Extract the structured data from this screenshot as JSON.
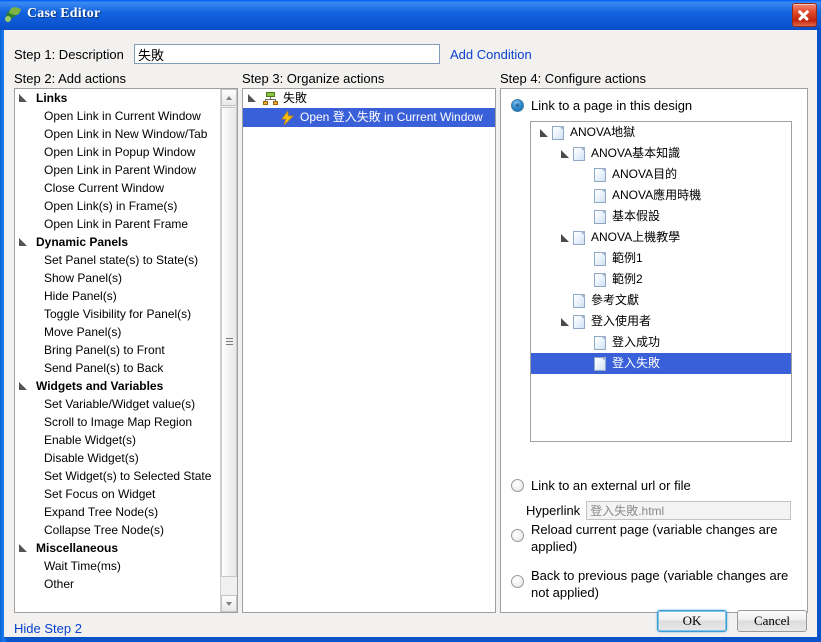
{
  "window": {
    "title": "Case Editor",
    "app_icon": "butterfly-icon",
    "close_icon": "close-icon"
  },
  "step1": {
    "label": "Step 1: Description",
    "description_value": "失敗",
    "description_placeholder": "",
    "add_condition": "Add Condition"
  },
  "headings": {
    "step2": "Step 2: Add actions",
    "step3": "Step 3: Organize actions",
    "step4": "Step 4: Configure actions"
  },
  "actions": [
    {
      "type": "group",
      "label": "Links"
    },
    {
      "type": "item",
      "label": "Open Link in Current Window"
    },
    {
      "type": "item",
      "label": "Open Link in New Window/Tab"
    },
    {
      "type": "item",
      "label": "Open Link in Popup Window"
    },
    {
      "type": "item",
      "label": "Open Link in Parent Window"
    },
    {
      "type": "item",
      "label": "Close Current Window"
    },
    {
      "type": "item",
      "label": "Open Link(s) in Frame(s)"
    },
    {
      "type": "item",
      "label": "Open Link in Parent Frame"
    },
    {
      "type": "group",
      "label": "Dynamic Panels"
    },
    {
      "type": "item",
      "label": "Set Panel state(s) to State(s)"
    },
    {
      "type": "item",
      "label": "Show Panel(s)"
    },
    {
      "type": "item",
      "label": "Hide Panel(s)"
    },
    {
      "type": "item",
      "label": "Toggle Visibility for Panel(s)"
    },
    {
      "type": "item",
      "label": "Move Panel(s)"
    },
    {
      "type": "item",
      "label": "Bring Panel(s) to Front"
    },
    {
      "type": "item",
      "label": "Send Panel(s) to Back"
    },
    {
      "type": "group",
      "label": "Widgets and Variables"
    },
    {
      "type": "item",
      "label": "Set Variable/Widget value(s)"
    },
    {
      "type": "item",
      "label": "Scroll to Image Map Region"
    },
    {
      "type": "item",
      "label": "Enable Widget(s)"
    },
    {
      "type": "item",
      "label": "Disable Widget(s)"
    },
    {
      "type": "item",
      "label": "Set Widget(s) to Selected State"
    },
    {
      "type": "item",
      "label": "Set Focus on Widget"
    },
    {
      "type": "item",
      "label": "Expand Tree Node(s)"
    },
    {
      "type": "item",
      "label": "Collapse Tree Node(s)"
    },
    {
      "type": "group",
      "label": "Miscellaneous"
    },
    {
      "type": "item",
      "label": "Wait Time(ms)"
    },
    {
      "type": "item",
      "label": "Other"
    }
  ],
  "organize": [
    {
      "label": "失敗",
      "icon": "sitemap-icon",
      "selected": false,
      "indent": 0
    },
    {
      "label": "Open 登入失敗 in Current Window",
      "icon": "lightning-bolt-icon",
      "selected": true,
      "indent": 1
    }
  ],
  "configure": {
    "option_design": "Link to a page in this design",
    "option_external": "Link to an external url or file",
    "option_reload": "Reload current page (variable changes are applied)",
    "option_back": "Back to previous page (variable changes are not applied)",
    "selected_option": "option_design",
    "hyperlink_label": "Hyperlink",
    "hyperlink_value": "登入失敗.html",
    "pages": [
      {
        "label": "ANOVA地獄",
        "depth": 0,
        "expandable": true,
        "selected": false
      },
      {
        "label": "ANOVA基本知識",
        "depth": 1,
        "expandable": true,
        "selected": false
      },
      {
        "label": "ANOVA目的",
        "depth": 2,
        "expandable": false,
        "selected": false
      },
      {
        "label": "ANOVA應用時機",
        "depth": 2,
        "expandable": false,
        "selected": false
      },
      {
        "label": "基本假設",
        "depth": 2,
        "expandable": false,
        "selected": false
      },
      {
        "label": "ANOVA上機教學",
        "depth": 1,
        "expandable": true,
        "selected": false
      },
      {
        "label": "範例1",
        "depth": 2,
        "expandable": false,
        "selected": false
      },
      {
        "label": "範例2",
        "depth": 2,
        "expandable": false,
        "selected": false
      },
      {
        "label": "參考文獻",
        "depth": 1,
        "expandable": false,
        "selected": false
      },
      {
        "label": "登入使用者",
        "depth": 1,
        "expandable": true,
        "selected": false
      },
      {
        "label": "登入成功",
        "depth": 2,
        "expandable": false,
        "selected": false
      },
      {
        "label": "登入失敗",
        "depth": 2,
        "expandable": false,
        "selected": true
      }
    ]
  },
  "footer": {
    "hide_step2": "Hide Step 2",
    "ok": "OK",
    "cancel": "Cancel"
  },
  "colors": {
    "title_bar": "#0a52c7",
    "selection": "#3960d8",
    "link": "#0b41cd",
    "close_button": "#c1240c"
  }
}
